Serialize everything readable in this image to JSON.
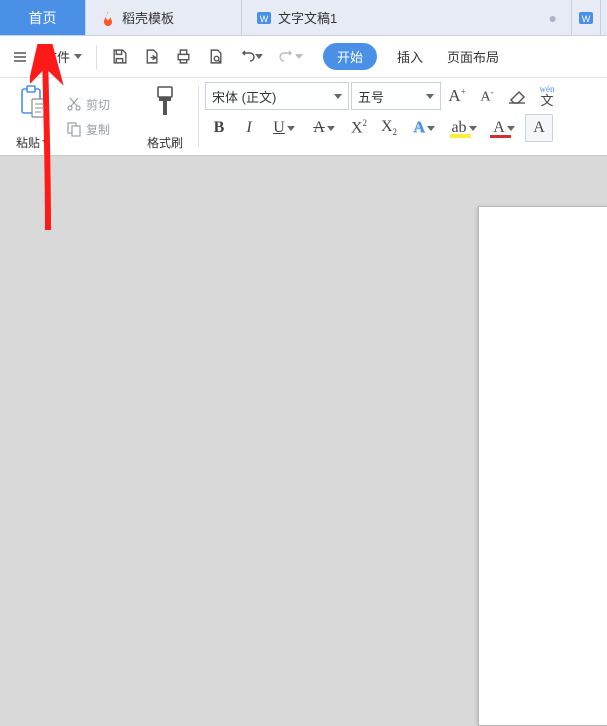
{
  "tabs": {
    "home": "首页",
    "docer": "稻壳模板",
    "doc1": "文字文稿1"
  },
  "toolbar": {
    "file_label": "文件"
  },
  "ribbon_tabs": {
    "start": "开始",
    "insert": "插入",
    "page_layout": "页面布局"
  },
  "clipboard": {
    "paste_label": "粘贴",
    "cut_label": "剪切",
    "copy_label": "复制",
    "format_painter_label": "格式刷"
  },
  "font": {
    "name": "宋体 (正文)",
    "size": "五号",
    "wen_accent": "wén"
  }
}
